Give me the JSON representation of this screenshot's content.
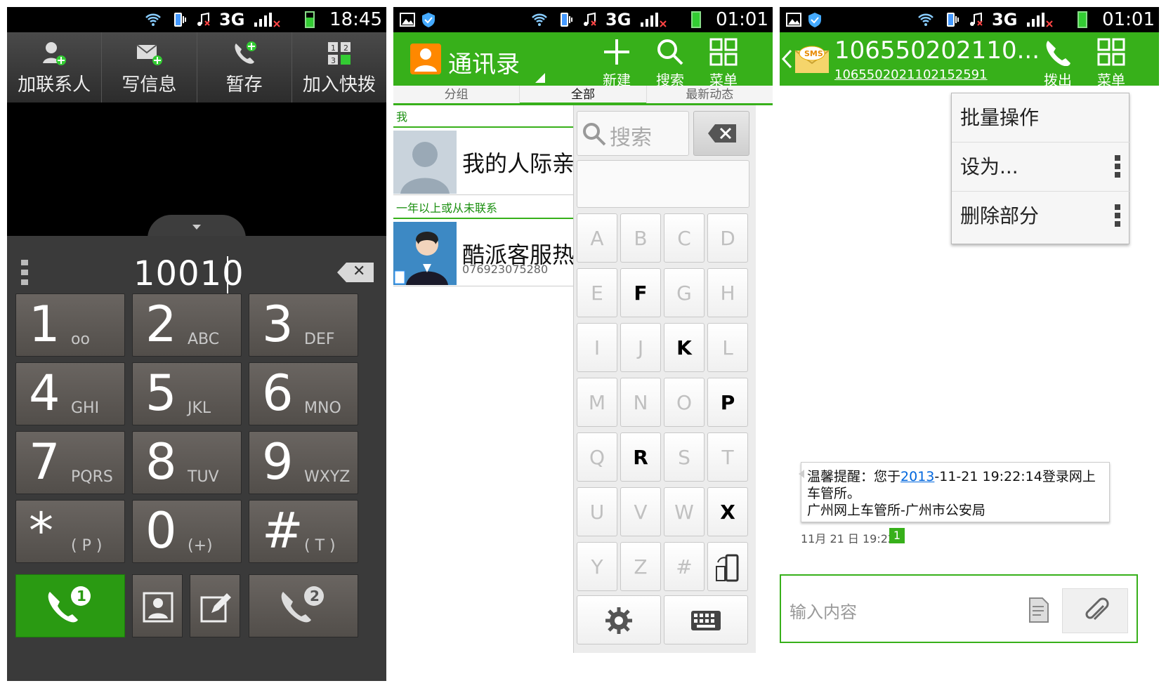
{
  "s1": {
    "time": "18:45",
    "net": "3G",
    "toolbar": [
      {
        "label": "加联系人",
        "icon": "add-contact-icon"
      },
      {
        "label": "写信息",
        "icon": "write-message-icon"
      },
      {
        "label": "暂存",
        "icon": "save-call-icon"
      },
      {
        "label": "加入快拨",
        "icon": "speed-dial-icon"
      }
    ],
    "number": "10010",
    "keys": [
      {
        "d": "1",
        "l": "ᴏᴏ"
      },
      {
        "d": "2",
        "l": "ABC"
      },
      {
        "d": "3",
        "l": "DEF"
      },
      {
        "d": "4",
        "l": "GHI"
      },
      {
        "d": "5",
        "l": "JKL"
      },
      {
        "d": "6",
        "l": "MNO"
      },
      {
        "d": "7",
        "l": "PQRS"
      },
      {
        "d": "8",
        "l": "TUV"
      },
      {
        "d": "9",
        "l": "WXYZ"
      },
      {
        "d": "*",
        "l": "( P )"
      },
      {
        "d": "0",
        "l": "(+)"
      },
      {
        "d": "#",
        "l": "( T )"
      }
    ],
    "call1_badge": "1",
    "call2_badge": "2"
  },
  "s2": {
    "time": "01:01",
    "net": "3G",
    "title": "通讯录",
    "actions": [
      {
        "label": "新建"
      },
      {
        "label": "搜索"
      },
      {
        "label": "菜单"
      }
    ],
    "tabs": [
      "分组",
      "全部",
      "最新动态"
    ],
    "active_tab": "全部",
    "sections": [
      "我",
      "一年以上或从未联系"
    ],
    "contacts": [
      {
        "name": "我的人际亲",
        "phone": ""
      },
      {
        "name": "酷派客服热",
        "phone": "076923075280"
      }
    ],
    "search_placeholder": "搜索",
    "letters": [
      "A",
      "B",
      "C",
      "D",
      "E",
      "F",
      "G",
      "H",
      "I",
      "J",
      "K",
      "L",
      "M",
      "N",
      "O",
      "P",
      "Q",
      "R",
      "S",
      "T",
      "U",
      "V",
      "W",
      "X",
      "Y",
      "Z",
      "#"
    ],
    "active_letters": [
      "F",
      "K",
      "P",
      "R",
      "X"
    ]
  },
  "s3": {
    "time": "01:01",
    "net": "3G",
    "number": "10655020211​0...",
    "number_full": "10655020211​02152591",
    "actions": [
      {
        "label": "拨出"
      },
      {
        "label": "菜单"
      }
    ],
    "menu": [
      "批量操作",
      "设为...",
      "删除部分"
    ],
    "message_pre": "温馨提醒：您于",
    "message_link": "2013",
    "message_post": "-11-21 19:22:14登录网上车管所。",
    "message_line2": "广州网上车管所-广州市公安局",
    "msg_time": "11月 21 日 19:22",
    "msg_badge": "1",
    "compose_placeholder": "输入内容"
  }
}
